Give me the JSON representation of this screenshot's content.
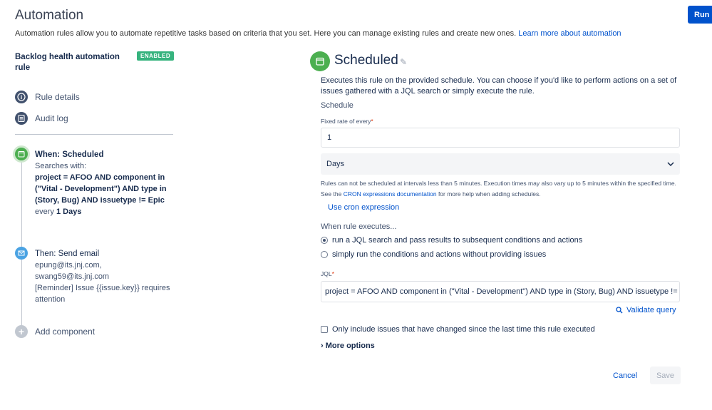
{
  "header": {
    "title": "Automation",
    "description": "Automation rules allow you to automate repetitive tasks based on criteria that you set. Here you can manage existing rules and create new ones.",
    "learn_more": "Learn more about automation",
    "run_button": "Run r"
  },
  "sidebar": {
    "rule_name": "Backlog health automation rule",
    "badge": "ENABLED",
    "links": [
      {
        "label": "Rule details",
        "icon": "info-icon"
      },
      {
        "label": "Audit log",
        "icon": "list-icon"
      }
    ],
    "when": {
      "title": "When: Scheduled",
      "searches_with": "Searches with:",
      "jql": "project = AFOO AND component in (\"Vital - Development\") AND type in (Story, Bug) AND issuetype != Epic",
      "every_prefix": "every",
      "every_value": "1 Days"
    },
    "then": {
      "title": "Then: Send email",
      "line1": "epung@its.jnj.com,",
      "line2": "swang59@its.jnj.com",
      "line3": "[Reminder] Issue {{issue.key}} requires attention"
    },
    "add_component": "Add component"
  },
  "panel": {
    "title": "Scheduled",
    "description": "Executes this rule on the provided schedule. You can choose if you'd like to perform actions on a set of issues gathered with a JQL search or simply execute the rule.",
    "schedule_label": "Schedule",
    "fixed_rate_label": "Fixed rate of every",
    "fixed_rate_value": "1",
    "unit_value": "Days",
    "help_before": "Rules can not be scheduled at intervals less than 5 minutes. Execution times may also vary up to 5 minutes within the specified time. See the",
    "help_link": "CRON expressions documentation",
    "help_after": "for more help when adding schedules.",
    "cron_link": "Use cron expression",
    "when_executes": "When rule executes...",
    "radio_jql": "run a JQL search and pass results to subsequent conditions and actions",
    "radio_simple": "simply run the conditions and actions without providing issues",
    "jql_label": "JQL",
    "jql_value": "project = AFOO AND component in (\"Vital - Development\") AND type in (Story, Bug) AND issuetype != Epic",
    "validate": "Validate query",
    "only_include": "Only include issues that have changed since the last time this rule executed",
    "more_options": "More options",
    "cancel": "Cancel",
    "save": "Save"
  }
}
